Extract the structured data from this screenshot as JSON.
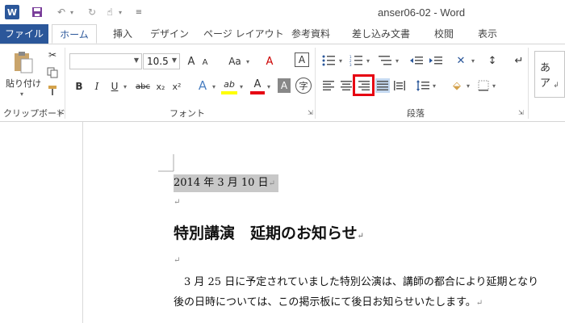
{
  "app": {
    "title": "anser06-02 - Word",
    "logo_letter": "W"
  },
  "qat": {
    "save_icon": "save-icon",
    "undo_icon": "undo-icon",
    "redo_icon": "redo-icon",
    "touch_icon": "touch-mode-icon",
    "customize_icon": "customize-qat-icon"
  },
  "tabs": [
    {
      "label": "ファイル"
    },
    {
      "label": "ホーム"
    },
    {
      "label": "挿入"
    },
    {
      "label": "デザイン"
    },
    {
      "label": "ページ レイアウト"
    },
    {
      "label": "参考資料"
    },
    {
      "label": "差し込み文書"
    },
    {
      "label": "校閲"
    },
    {
      "label": "表示"
    }
  ],
  "ribbon": {
    "clipboard": {
      "label": "クリップボード",
      "paste_label": "貼り付け"
    },
    "font": {
      "label": "フォント",
      "font_name": "",
      "font_size": "10.5",
      "grow": "A",
      "shrink": "A",
      "case": "Aa",
      "clear": "A",
      "bold": "B",
      "italic": "I",
      "underline": "U",
      "strike": "abc",
      "subscript": "x₂",
      "superscript": "x²",
      "effects": "A",
      "highlight": "ab",
      "color": "A",
      "shading": "A",
      "enclose": "字"
    },
    "paragraph": {
      "label": "段落"
    },
    "styles": {
      "preview": "あ ア"
    }
  },
  "document": {
    "date": "2014 年 3 月 10 日",
    "heading": "特別講演　延期のお知らせ",
    "body_line1": "　3 月 25 日に予定されていました特別公演は、講師の都合により延期となり",
    "body_line2": "後の日時については、この掲示板にて後日お知らせいたします。",
    "para_mark": "↵"
  },
  "colors": {
    "brand": "#2b579a",
    "highlight_box": "#e60012",
    "selection": "#c8c8c8",
    "highlight_yellow": "#ffff00",
    "font_red": "#e60012"
  }
}
